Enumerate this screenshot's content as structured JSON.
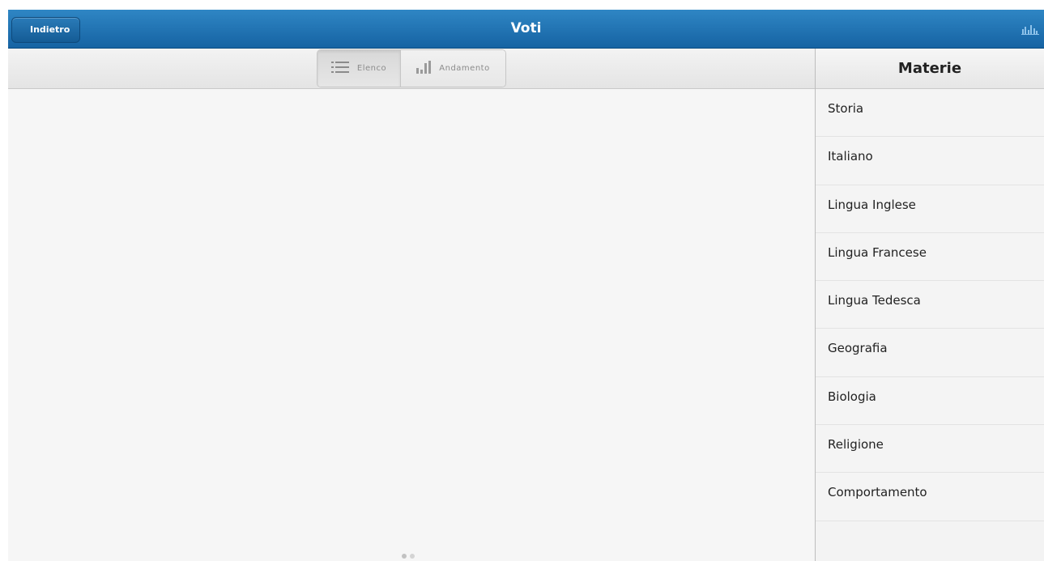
{
  "header": {
    "back_label": "Indietro",
    "title": "Voti",
    "stats_icon": "stats-icon"
  },
  "toolbar": {
    "segments": [
      {
        "label": "Elenco",
        "icon": "list-icon",
        "active": true
      },
      {
        "label": "Andamento",
        "icon": "bar-chart-icon",
        "active": false
      }
    ]
  },
  "pager": {
    "pages": 2,
    "current": 1
  },
  "sidebar": {
    "title": "Materie",
    "subjects": [
      "Storia",
      "Italiano",
      "Lingua Inglese",
      "Lingua Francese",
      "Lingua Tedesca",
      "Geografia",
      "Biologia",
      "Religione",
      "Comportamento"
    ]
  },
  "colors": {
    "header_blue": "#1f72b4",
    "text_dark": "#222222",
    "text_muted": "#8b8b8b"
  }
}
